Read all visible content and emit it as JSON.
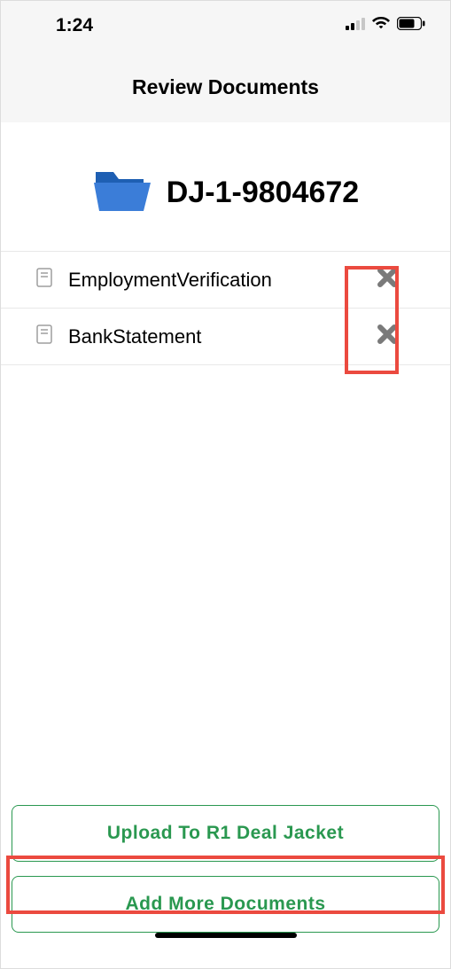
{
  "status": {
    "time": "1:24"
  },
  "header": {
    "title": "Review Documents"
  },
  "folder": {
    "label": "DJ-1-9804672"
  },
  "documents": [
    {
      "name": "EmploymentVerification"
    },
    {
      "name": "BankStatement"
    }
  ],
  "buttons": {
    "upload": "Upload To R1 Deal Jacket",
    "add_more": "Add More Documents"
  }
}
